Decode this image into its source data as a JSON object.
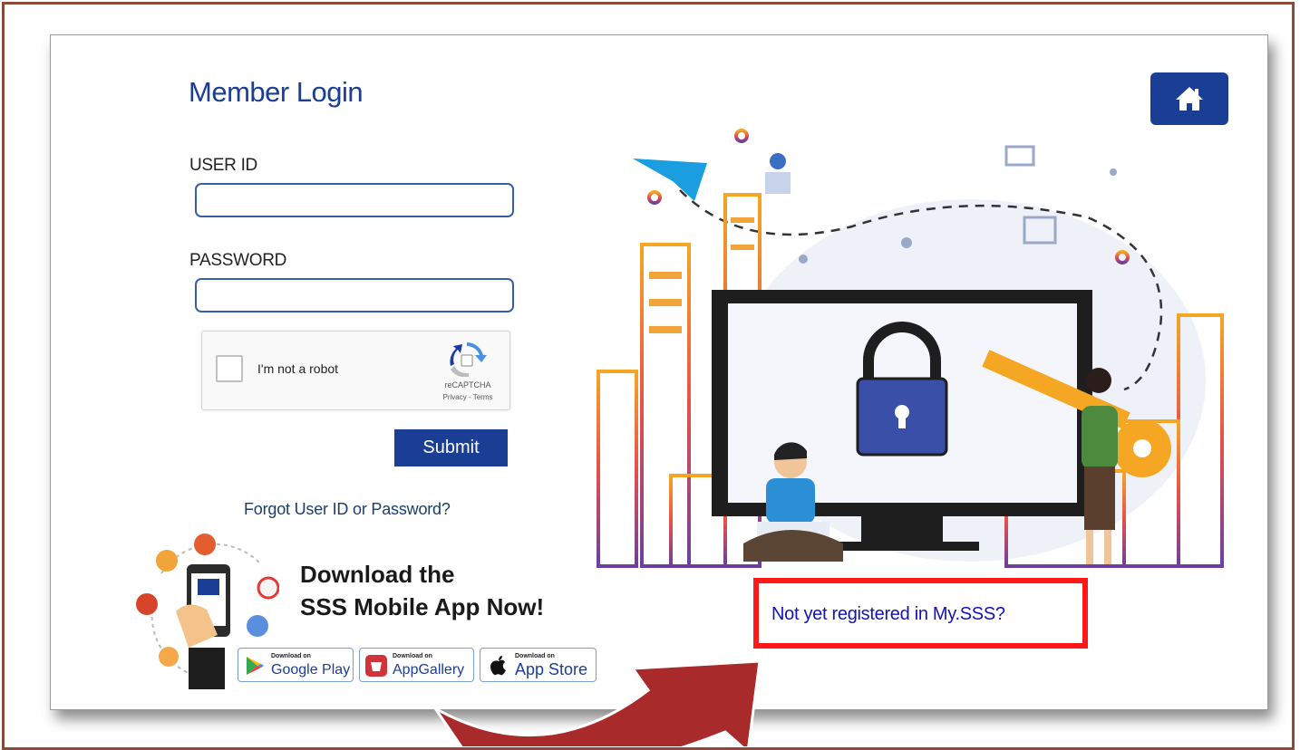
{
  "login": {
    "title": "Member Login",
    "user_id_label": "USER ID",
    "user_id_value": "",
    "password_label": "PASSWORD",
    "password_value": "",
    "submit_label": "Submit",
    "forgot_link": "Forgot User ID or Password?"
  },
  "captcha": {
    "label": "I'm not a robot",
    "brand": "reCAPTCHA",
    "links": "Privacy - Terms"
  },
  "download": {
    "line1": "Download the",
    "line2": "SSS Mobile App Now!"
  },
  "stores": [
    {
      "small": "Download on",
      "big": "Google Play",
      "icon": "google-play-icon"
    },
    {
      "small": "Download on",
      "big": "AppGallery",
      "icon": "huawei-icon"
    },
    {
      "small": "Download on",
      "big": "App Store",
      "icon": "apple-icon"
    }
  ],
  "register": {
    "link": "Not yet registered in My.SSS?"
  },
  "colors": {
    "brand_blue": "#1b3e95",
    "highlight_red": "#ff1a1a",
    "arrow_red": "#a82a2a",
    "frame_brown": "#8b4a3a"
  },
  "icons": {
    "home": "home-icon",
    "lock": "padlock-icon",
    "key": "key-icon"
  }
}
